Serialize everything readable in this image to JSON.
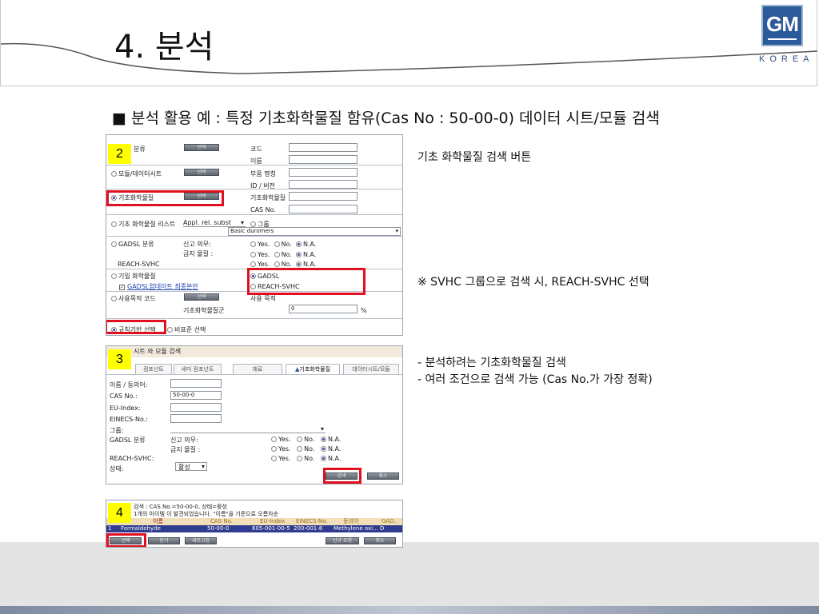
{
  "slide": {
    "title": "4. 분석",
    "subtitle": "■ 분석 활용 예 : 특정 기초화학물질 함유(Cas No : 50-00-0) 데이터 시트/모듈   검색",
    "logo": {
      "top": "GM",
      "bottom": "KOREA"
    },
    "notes": {
      "n1": "기초 화학물질 검색 버튼",
      "n2": "※ SVHC 그룹으로 검색 시, REACH-SVHC 선택",
      "n3_line1": "- 분석하려는 기초화학물질 검색",
      "n3_line2": "- 여러 조건으로 검색 가능 (Cas No.가 가장 정확)"
    },
    "badges": {
      "b2": "2",
      "b3": "3",
      "b4": "4"
    }
  },
  "panel1": {
    "rows": {
      "classification": "분류",
      "module": "모듈/데이터시트",
      "basic_chem": "기초화학물질",
      "chem_list": "기초 화학물질 리스트",
      "chem_list_value": "Appl. rel. subst",
      "gadsl": "GADSL 분류",
      "reach": "REACH-SVHC",
      "secret": "기밀 화학물질",
      "gadsl_update": "GADSL업데이트 최종본만",
      "usage": "사용목적 코드",
      "basic_group": "기초화학물질군",
      "rule_select": "규칙기반 선택",
      "nonstd_select": "비표준 선택"
    },
    "button_label": "선택",
    "right": {
      "code": "코드",
      "name": "이름",
      "part": "부품 명칭",
      "id_ver": "ID / 버전",
      "basic_chem": "기초화학물질",
      "cas": "CAS No.",
      "group": "그룹",
      "group_value": "Basic duromers",
      "gadsl_opt": "GADSL",
      "reach_opt": "REACH-SVHC",
      "usage_pct": "사용 목적",
      "pct_value": "0",
      "pct_unit": "%"
    },
    "gadsl_fields": {
      "report": "신고 의무:",
      "ban": "금지 물질 :"
    },
    "yes": "Yes.",
    "no": "No.",
    "na": "N.A."
  },
  "panel2": {
    "header": "시트 와 모듈 검색",
    "tabs": [
      "컴포넌트",
      "세미 컴포넌트",
      "재료",
      "기초화학물질",
      "데이터시트/모듈"
    ],
    "fields": {
      "name": "이름 / 동의어:",
      "cas": "CAS No.:",
      "cas_value": "50-00-0",
      "eu": "EU-Index:",
      "einecs": "EINECS-No.:",
      "group": "그룹:",
      "gadsl": "GADSL 분류",
      "report": "신고 의무:",
      "ban": "금지 물질 :",
      "reach": "REACH-SVHC:",
      "status": "상태:",
      "status_value": "활성"
    },
    "yes": "Yes.",
    "no": "No.",
    "na": "N.A.",
    "search_btn": "검색",
    "cancel_btn": "취소"
  },
  "panel3": {
    "line1": "검색 : CAS No.=50-00-0, 상태=활성",
    "line2": "1개의 아이템 이 발견되었습니다. \"이름\"을 기준으로 오름차순",
    "columns": [
      "이름",
      "CAS No.",
      "EU-Index",
      "EINECS-No.",
      "동의어",
      "GAD.."
    ],
    "row_index": "1",
    "row": [
      "Formaldehyde",
      "50-00-0",
      "605-001-00-5",
      "200-001-8",
      "Methylene oxi...",
      "D"
    ],
    "buttons": [
      "선택",
      "닫기",
      "새로고침",
      "신규 요청",
      "취소"
    ]
  }
}
